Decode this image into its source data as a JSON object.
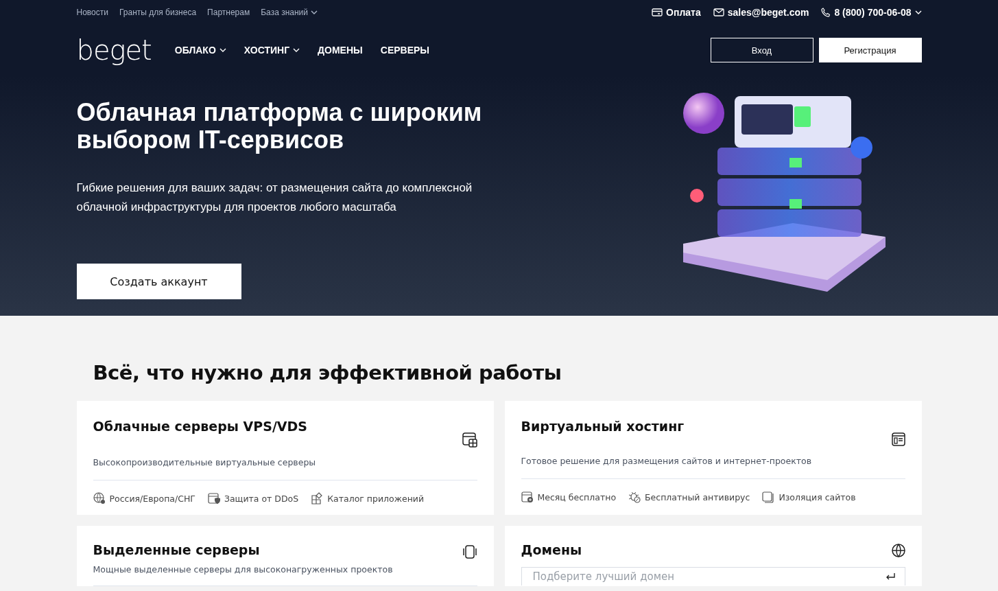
{
  "top_links": [
    {
      "label": "Новости",
      "has_menu": false
    },
    {
      "label": "Гранты для бизнеса",
      "has_menu": false
    },
    {
      "label": "Партнерам",
      "has_menu": false
    },
    {
      "label": "База знаний",
      "has_menu": true
    }
  ],
  "contacts": {
    "payment": "Оплата",
    "email": "sales@beget.com",
    "phone": "8 (800) 700-06-08"
  },
  "logo": "beget",
  "nav": [
    {
      "label": "ОБЛАКО",
      "has_menu": true
    },
    {
      "label": "ХОСТИНГ",
      "has_menu": true
    },
    {
      "label": "ДОМЕНЫ",
      "has_menu": false
    },
    {
      "label": "СЕРВЕРЫ",
      "has_menu": false
    }
  ],
  "auth_buttons": [
    {
      "label": "Вход",
      "kind": "outline"
    },
    {
      "label": "Регистрация",
      "kind": "solid"
    }
  ],
  "hero": {
    "title": "Облачная платформа с широким выбором IT-сервисов",
    "subtitle": "Гибкие решения для ваших задач: от размещения сайта до комплексной облачной инфраструктуры для проектов любого масштаба",
    "button": "Создать аккаунт"
  },
  "section_title": "Всё, что нужно для эффективной работы",
  "cards": [
    {
      "kind": "features",
      "title": "Облачные серверы VPS/VDS",
      "description": "Высокопроизводительные виртуальные серверы",
      "features": [
        "Россия/Европа/СНГ",
        "Защита от DDoS",
        "Каталог приложений"
      ]
    },
    {
      "kind": "features",
      "title": "Виртуальный хостинг",
      "description": "Готовое решение для размещения сайтов и интернет-проектов",
      "features": [
        "Месяц бесплатно",
        "Бесплатный антивирус",
        "Изоляция сайтов"
      ]
    },
    {
      "kind": "features",
      "title": "Выделенные серверы",
      "description": "Мощные выделенные серверы для высоконагруженных проектов"
    },
    {
      "kind": "search",
      "title": "Домены",
      "placeholder": "Подберите лучший домен"
    }
  ]
}
